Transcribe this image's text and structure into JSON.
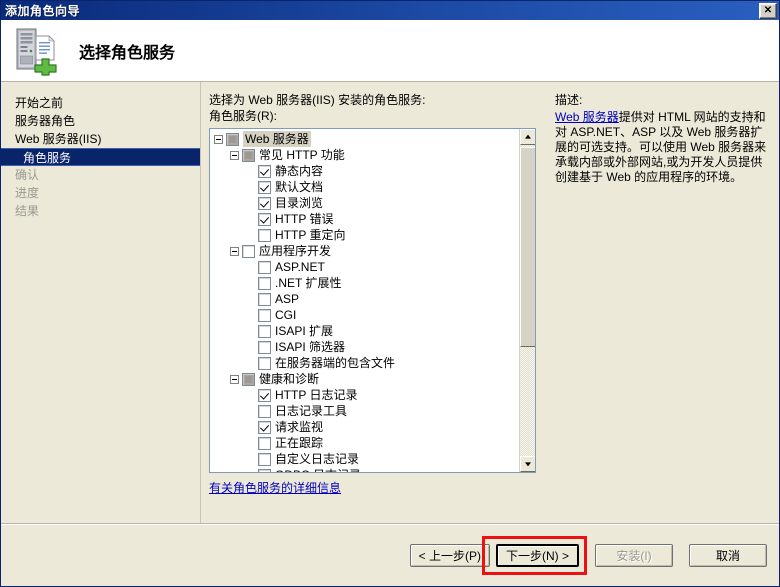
{
  "window": {
    "title": "添加角色向导",
    "close_label": "✕"
  },
  "header": {
    "title": "选择角色服务",
    "icon": "server-add-icon"
  },
  "sidebar": {
    "items": [
      {
        "label": "开始之前",
        "state": "normal"
      },
      {
        "label": "服务器角色",
        "state": "normal"
      },
      {
        "label": "Web 服务器(IIS)",
        "state": "normal"
      },
      {
        "label": "角色服务",
        "state": "selected"
      },
      {
        "label": "确认",
        "state": "dim"
      },
      {
        "label": "进度",
        "state": "dim"
      },
      {
        "label": "结果",
        "state": "dim"
      }
    ]
  },
  "main": {
    "intro": "选择为 Web 服务器(IIS) 安装的角色服务:",
    "list_label": "角色服务(R):",
    "more_link": "有关角色服务的详细信息",
    "tree": [
      {
        "label": "Web 服务器",
        "indent": 0,
        "check": "partial",
        "expander": true,
        "selected": true
      },
      {
        "label": "常见 HTTP 功能",
        "indent": 1,
        "check": "partial",
        "expander": true,
        "selected": false
      },
      {
        "label": "静态内容",
        "indent": 2,
        "check": "checked",
        "expander": false,
        "selected": false
      },
      {
        "label": "默认文档",
        "indent": 2,
        "check": "checked",
        "expander": false,
        "selected": false
      },
      {
        "label": "目录浏览",
        "indent": 2,
        "check": "checked",
        "expander": false,
        "selected": false
      },
      {
        "label": "HTTP 错误",
        "indent": 2,
        "check": "checked",
        "expander": false,
        "selected": false
      },
      {
        "label": "HTTP 重定向",
        "indent": 2,
        "check": "unchecked",
        "expander": false,
        "selected": false
      },
      {
        "label": "应用程序开发",
        "indent": 1,
        "check": "unchecked",
        "expander": true,
        "selected": false
      },
      {
        "label": "ASP.NET",
        "indent": 2,
        "check": "unchecked",
        "expander": false,
        "selected": false
      },
      {
        "label": ".NET 扩展性",
        "indent": 2,
        "check": "unchecked",
        "expander": false,
        "selected": false
      },
      {
        "label": "ASP",
        "indent": 2,
        "check": "unchecked",
        "expander": false,
        "selected": false
      },
      {
        "label": "CGI",
        "indent": 2,
        "check": "unchecked",
        "expander": false,
        "selected": false
      },
      {
        "label": "ISAPI 扩展",
        "indent": 2,
        "check": "unchecked",
        "expander": false,
        "selected": false
      },
      {
        "label": "ISAPI 筛选器",
        "indent": 2,
        "check": "unchecked",
        "expander": false,
        "selected": false
      },
      {
        "label": "在服务器端的包含文件",
        "indent": 2,
        "check": "unchecked",
        "expander": false,
        "selected": false
      },
      {
        "label": "健康和诊断",
        "indent": 1,
        "check": "partial",
        "expander": true,
        "selected": false
      },
      {
        "label": "HTTP 日志记录",
        "indent": 2,
        "check": "checked",
        "expander": false,
        "selected": false
      },
      {
        "label": "日志记录工具",
        "indent": 2,
        "check": "unchecked",
        "expander": false,
        "selected": false
      },
      {
        "label": "请求监视",
        "indent": 2,
        "check": "checked",
        "expander": false,
        "selected": false
      },
      {
        "label": "正在跟踪",
        "indent": 2,
        "check": "unchecked",
        "expander": false,
        "selected": false
      },
      {
        "label": "自定义日志记录",
        "indent": 2,
        "check": "unchecked",
        "expander": false,
        "selected": false
      },
      {
        "label": "ODBC 日志记录",
        "indent": 2,
        "check": "unchecked",
        "expander": false,
        "selected": false
      }
    ]
  },
  "description": {
    "title": "描述:",
    "link": "Web 服务器",
    "text": "提供对 HTML 网站的支持和对 ASP.NET、ASP 以及 Web 服务器扩展的可选支持。可以使用 Web 服务器来承载内部或外部网站,或为开发人员提供创建基于 Web 的应用程序的环境。"
  },
  "footer": {
    "back": "< 上一步(P)",
    "next": "下一步(N) >",
    "install": "安装(I)",
    "cancel": "取消"
  }
}
